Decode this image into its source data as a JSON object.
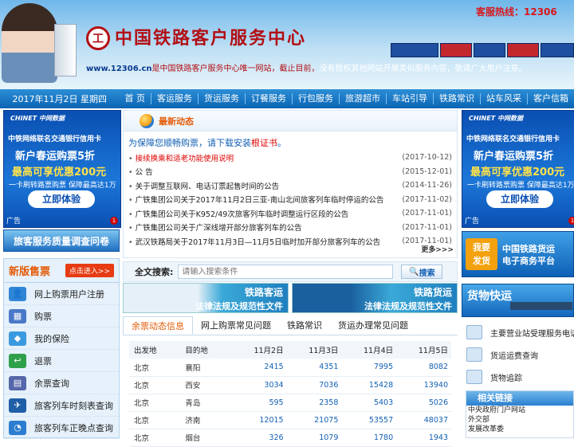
{
  "header": {
    "hotline": "客服热线：12306",
    "site_title": "中国铁路客户服务中心",
    "logo_text": "工",
    "notice_url": "www.12306.cn",
    "notice_red": "是中国铁路客户服务中心唯一网站，截止目前，",
    "notice_rest": "没有授权其他网站开展类似服务内容，敬请广大用户注意。"
  },
  "nav": {
    "date": "2017年11月2日 星期四",
    "items": [
      "首 页",
      "客运服务",
      "货运服务",
      "订餐服务",
      "行包服务",
      "旅游超市",
      "车站引导",
      "铁路常识",
      "站车风采",
      "客户信箱"
    ]
  },
  "ad": {
    "brand": "CHINET 中网数据",
    "line1": "中铁网络联名交通银行信用卡",
    "line2": "新户春运购票5折",
    "line3": "最高可享优惠200元",
    "line4": "一卡刷转路票购票 保障最高达1万",
    "button": "立即体验",
    "label": "广告",
    "close": "1"
  },
  "survey": "旅客服务质量调查问卷",
  "ticket_panel": {
    "title": "新版售票",
    "entry": "点击进入>>",
    "items": [
      {
        "label": "网上购票用户注册",
        "icon": "user-register-icon",
        "color": "#2f86d6",
        "glyph": "👤"
      },
      {
        "label": "购票",
        "icon": "ticket-icon",
        "color": "#4a78c8",
        "glyph": "▦"
      },
      {
        "label": "我的保险",
        "icon": "shield-icon",
        "color": "#3a9ae0",
        "glyph": "◆"
      },
      {
        "label": "退票",
        "icon": "refund-icon",
        "color": "#2ea04a",
        "glyph": "↩"
      },
      {
        "label": "余票查询",
        "icon": "query-icon",
        "color": "#5566aa",
        "glyph": "▤"
      },
      {
        "label": "旅客列车时刻表查询",
        "icon": "timetable-icon",
        "color": "#1e5fa8",
        "glyph": "✈"
      },
      {
        "label": "旅客列车正晚点查询",
        "icon": "clock-icon",
        "color": "#2c7dd0",
        "glyph": "◔"
      }
    ]
  },
  "news": {
    "title": "最新动态",
    "tip_prefix": "为保障您顺畅购票，",
    "tip_link": "请下载安装",
    "tip_hl": "根证书",
    "tip_end": "。",
    "items": [
      {
        "text": "接续换乘和适老功能使用说明",
        "date": "(2017-10-12)",
        "red": true
      },
      {
        "text": "公 告",
        "date": "(2015-12-01)",
        "red": false
      },
      {
        "text": "关于调整互联网、电话订票起售时间的公告",
        "date": "(2014-11-26)",
        "red": false
      },
      {
        "text": "广铁集团公司关于2017年11月2日三亚-南山北间旅客列车临时停运的公告",
        "date": "(2017-11-02)",
        "red": false
      },
      {
        "text": "广铁集团公司关于K952/49次旅客列车临时调整运行区段的公告",
        "date": "(2017-11-01)",
        "red": false
      },
      {
        "text": "广铁集团公司关于广深线增开部分旅客列车的公告",
        "date": "(2017-11-01)",
        "red": false
      },
      {
        "text": "武汉铁路局关于2017年11月3日—11月5日临时加开部分旅客列车的公告",
        "date": "(2017-11-01)",
        "red": false
      }
    ],
    "more": "更多>>>"
  },
  "search": {
    "label": "全文搜索:",
    "placeholder": "请输入搜索条件",
    "button": "搜索"
  },
  "banners": [
    {
      "t1": "铁路客运",
      "t2": "法律法规及规范性文件"
    },
    {
      "t1": "铁路货运",
      "t2": "法律法规及规范性文件"
    }
  ],
  "tabs": [
    "余票动态信息",
    "网上购票常见问题",
    "铁路常识",
    "货运办理常见问题"
  ],
  "ticket_table": {
    "headers": [
      "出发地",
      "目的地",
      "11月2日",
      "11月3日",
      "11月4日",
      "11月5日"
    ],
    "rows": [
      [
        "北京",
        "襄阳",
        "2415",
        "4351",
        "7995",
        "8082"
      ],
      [
        "北京",
        "西安",
        "3034",
        "7036",
        "15428",
        "13940"
      ],
      [
        "北京",
        "青岛",
        "595",
        "2358",
        "5403",
        "5026"
      ],
      [
        "北京",
        "济南",
        "12015",
        "21075",
        "53557",
        "48037"
      ],
      [
        "北京",
        "烟台",
        "326",
        "1079",
        "1780",
        "1943"
      ]
    ]
  },
  "ecom": {
    "badge1": "我要",
    "badge2": "发货",
    "text1": "中国铁路货运",
    "text2": "电子商务平台"
  },
  "freight": "货物快运",
  "right_links": [
    "主要营业站受理服务电话",
    "货运运费查询",
    "货物追踪"
  ],
  "related": {
    "title": "相关链接",
    "items": [
      "中央政府门户网站",
      "外交部",
      "发展改革委"
    ]
  }
}
